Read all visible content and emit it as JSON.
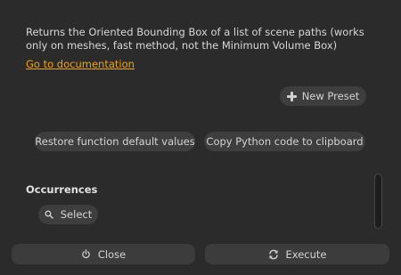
{
  "description": "Returns the Oriented Bounding Box of a list of scene paths (works only on meshes, fast method, not the Minimum Volume Box)",
  "documentation_link": "Go to documentation",
  "presets": {
    "new_preset_label": "New Preset"
  },
  "actions": {
    "restore_label": "Restore function default values",
    "copy_python_label": "Copy Python code to clipboard"
  },
  "occurrences": {
    "title": "Occurrences",
    "select_label": "Select"
  },
  "footer": {
    "close_label": "Close",
    "execute_label": "Execute"
  },
  "colors": {
    "background": "#2b2b2b",
    "link": "#f0a500",
    "button": "#3e3e3e"
  },
  "icons": {
    "new_preset": "plus-icon",
    "select": "search-icon",
    "close": "power-icon",
    "execute": "refresh-icon"
  }
}
